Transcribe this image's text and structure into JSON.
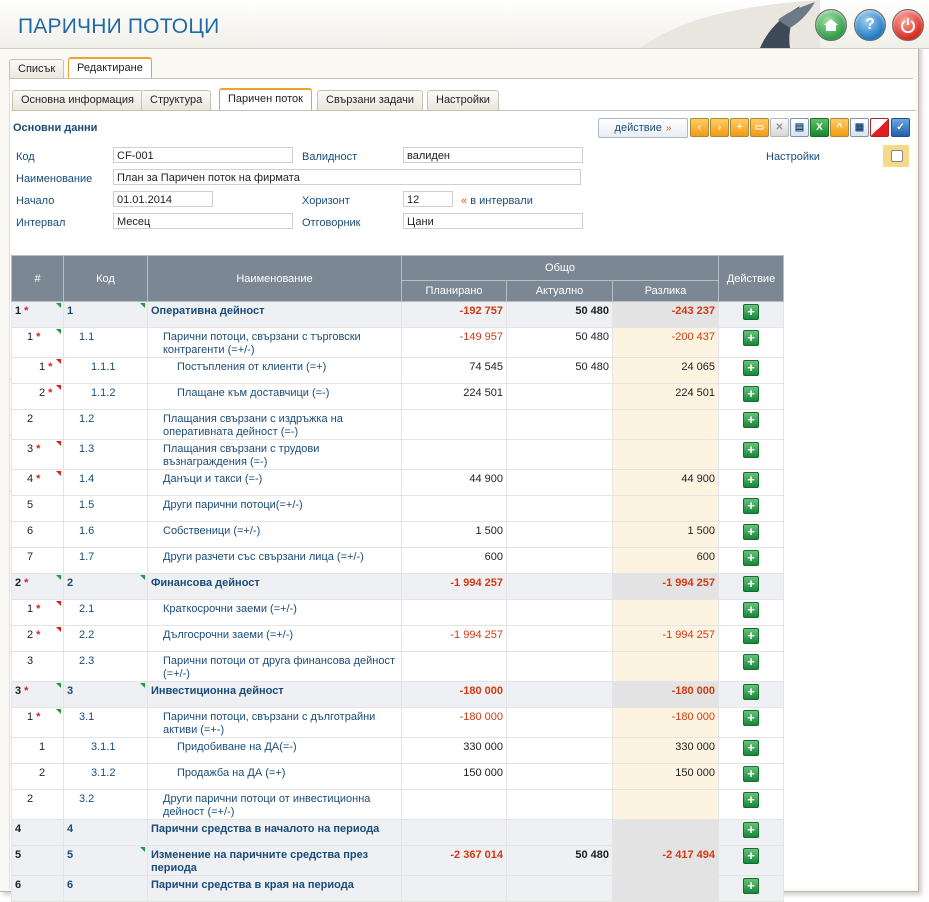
{
  "header": {
    "title": "ПАРИЧНИ ПОТОЦИ"
  },
  "top_tabs": [
    {
      "label": "Списък"
    },
    {
      "label": "Редактиране"
    }
  ],
  "sub_tabs": [
    {
      "label": "Основна информация"
    },
    {
      "label": "Структура"
    },
    {
      "label": "Паричен поток"
    },
    {
      "label": "Свързани задачи"
    },
    {
      "label": "Настройки"
    }
  ],
  "section": {
    "title": "Основни данни",
    "action_label": "действие"
  },
  "form": {
    "code_label": "Код",
    "code_value": "CF-001",
    "validity_label": "Валидност",
    "validity_value": "валиден",
    "name_label": "Наименование",
    "name_value": "План за Паричен поток на фирмата",
    "start_label": "Начало",
    "start_value": "01.01.2014",
    "horizon_label": "Хоризонт",
    "horizon_value": "12",
    "horizon_link": "в интервали",
    "interval_label": "Интервал",
    "interval_value": "Месец",
    "owner_label": "Отговорник",
    "owner_value": "Цани",
    "settings_label": "Настройки"
  },
  "table": {
    "headers": {
      "idx": "#",
      "code": "Код",
      "name": "Наименование",
      "total": "Общо",
      "planned": "Планирано",
      "actual": "Актуално",
      "diff": "Разлика",
      "action": "Действие"
    },
    "rows": [
      {
        "idx": "1",
        "star": "*",
        "code": "1",
        "name": "Оперативна дейност",
        "planned": "-192 757",
        "actual": "50 480",
        "diff": "-243 237",
        "level": 0
      },
      {
        "idx": "1",
        "star": "*",
        "code": "1.1",
        "name": "Парични потоци, свързани с търговски контрагенти (=+/-)",
        "planned": "-149 957",
        "actual": "50 480",
        "diff": "-200 437",
        "level": 1
      },
      {
        "idx": "1",
        "star": "*",
        "code": "1.1.1",
        "name": "Постъпления от клиенти (=+)",
        "planned": "74 545",
        "actual": "50 480",
        "diff": "24 065",
        "level": 2
      },
      {
        "idx": "2",
        "star": "*",
        "code": "1.1.2",
        "name": "Плащане към доставчици (=-)",
        "planned": "224 501",
        "actual": "",
        "diff": "224 501",
        "level": 2
      },
      {
        "idx": "2",
        "star": "",
        "code": "1.2",
        "name": "Плащания свързани с издръжка на оперативната дейност (=-)",
        "planned": "",
        "actual": "",
        "diff": "",
        "level": 1
      },
      {
        "idx": "3",
        "star": "*",
        "code": "1.3",
        "name": "Плащания свързани с трудови възнаграждения (=-)",
        "planned": "",
        "actual": "",
        "diff": "",
        "level": 1
      },
      {
        "idx": "4",
        "star": "*",
        "code": "1.4",
        "name": "Данъци и такси (=-)",
        "planned": "44 900",
        "actual": "",
        "diff": "44 900",
        "level": 1
      },
      {
        "idx": "5",
        "star": "",
        "code": "1.5",
        "name": "Други парични потоци(=+/-)",
        "planned": "",
        "actual": "",
        "diff": "",
        "level": 1
      },
      {
        "idx": "6",
        "star": "",
        "code": "1.6",
        "name": "Собственици (=+/-)",
        "planned": "1 500",
        "actual": "",
        "diff": "1 500",
        "level": 1
      },
      {
        "idx": "7",
        "star": "",
        "code": "1.7",
        "name": "Други разчети със свързани лица (=+/-)",
        "planned": "600",
        "actual": "",
        "diff": "600",
        "level": 1
      },
      {
        "idx": "2",
        "star": "*",
        "code": "2",
        "name": "Финансова дейност",
        "planned": "-1 994 257",
        "actual": "",
        "diff": "-1 994 257",
        "level": 0
      },
      {
        "idx": "1",
        "star": "*",
        "code": "2.1",
        "name": "Краткосрочни заеми (=+/-)",
        "planned": "",
        "actual": "",
        "diff": "",
        "level": 1
      },
      {
        "idx": "2",
        "star": "*",
        "code": "2.2",
        "name": "Дългосрочни заеми (=+/-)",
        "planned": "-1 994 257",
        "actual": "",
        "diff": "-1 994 257",
        "level": 1
      },
      {
        "idx": "3",
        "star": "",
        "code": "2.3",
        "name": "Парични потоци от друга финансова дейност (=+/-)",
        "planned": "",
        "actual": "",
        "diff": "",
        "level": 1
      },
      {
        "idx": "3",
        "star": "*",
        "code": "3",
        "name": "Инвестиционна дейност",
        "planned": "-180 000",
        "actual": "",
        "diff": "-180 000",
        "level": 0
      },
      {
        "idx": "1",
        "star": "*",
        "code": "3.1",
        "name": "Парични потоци, свързани с дълготрайни активи (=+-)",
        "planned": "-180 000",
        "actual": "",
        "diff": "-180 000",
        "level": 1
      },
      {
        "idx": "1",
        "star": "",
        "code": "3.1.1",
        "name": "Придобиване на ДА(=-)",
        "planned": "330 000",
        "actual": "",
        "diff": "330 000",
        "level": 2
      },
      {
        "idx": "2",
        "star": "",
        "code": "3.1.2",
        "name": "Продажба на ДА (=+)",
        "planned": "150 000",
        "actual": "",
        "diff": "150 000",
        "level": 2
      },
      {
        "idx": "2",
        "star": "",
        "code": "3.2",
        "name": "Други парични потоци от инвестиционна дейност (=+/-)",
        "planned": "",
        "actual": "",
        "diff": "",
        "level": 1
      },
      {
        "idx": "4",
        "star": "",
        "code": "4",
        "name": "Парични средства в началото на периода",
        "planned": "",
        "actual": "",
        "diff": "",
        "level": 0
      },
      {
        "idx": "5",
        "star": "",
        "code": "5",
        "name": "Изменение на паричните средства през периода",
        "planned": "-2 367 014",
        "actual": "50 480",
        "diff": "-2 417 494",
        "level": 0
      },
      {
        "idx": "6",
        "star": "",
        "code": "6",
        "name": "Парични средства в края на периода",
        "planned": "",
        "actual": "",
        "diff": "",
        "level": 0
      }
    ]
  }
}
